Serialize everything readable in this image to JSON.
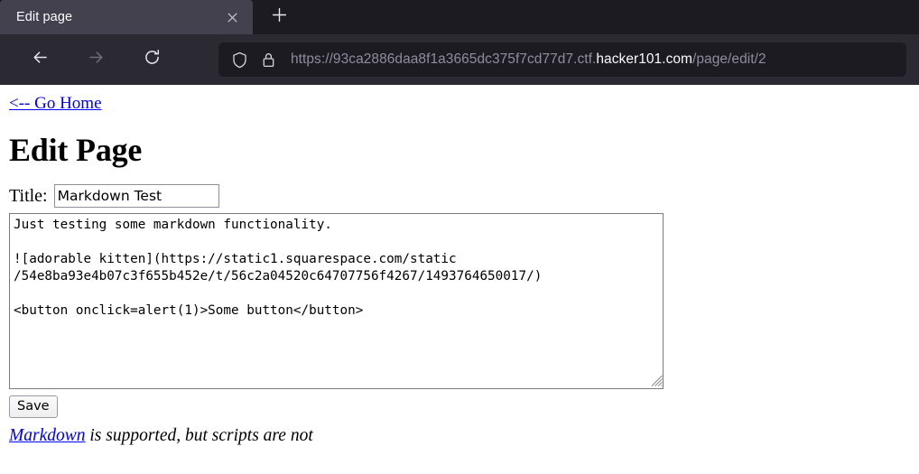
{
  "browser": {
    "tab": {
      "title": "Edit page",
      "close_icon": "close-icon"
    },
    "new_tab_icon": "plus-icon",
    "nav": {
      "back_icon": "arrow-left-icon",
      "forward_icon": "arrow-right-icon",
      "reload_icon": "reload-icon"
    },
    "urlbar": {
      "shield_icon": "shield-icon",
      "lock_icon": "lock-icon",
      "url_prefix": "https://93ca2886daa8f1a3665dc375f7cd77d7.ctf.",
      "url_domain": "hacker101.com",
      "url_path": "/page/edit/2",
      "full_url": "https://93ca2886daa8f1a3665dc375f7cd77d7.ctf.hacker101.com/page/edit/2"
    },
    "colors": {
      "window_bg": "#1c1b22",
      "toolbar_bg": "#2b2a33",
      "active_tab_bg": "#42414d",
      "text_light": "#fbfbfe",
      "text_dim": "#8f8d9b",
      "disabled_icon": "#6e6d78"
    }
  },
  "page": {
    "go_home_link": "<-- Go Home",
    "heading": "Edit Page",
    "title_label": "Title:",
    "title_input": {
      "value": "Markdown Test",
      "placeholder": ""
    },
    "body_textarea": {
      "value": "Just testing some markdown functionality.\n\n![adorable kitten](https://static1.squarespace.com/static\n/54e8ba93e4b07c3f655b452e/t/56c2a04520c64707756f4267/1493764650017/)\n\n<button onclick=alert(1)>Some button</button>",
      "placeholder": ""
    },
    "save_button": "Save",
    "footer": {
      "link_text": "Markdown",
      "rest_text": " is supported, but scripts are not"
    },
    "colors": {
      "link": "#0000ee",
      "text": "#000000",
      "background": "#ffffff",
      "input_border": "#8f8f9d"
    }
  }
}
